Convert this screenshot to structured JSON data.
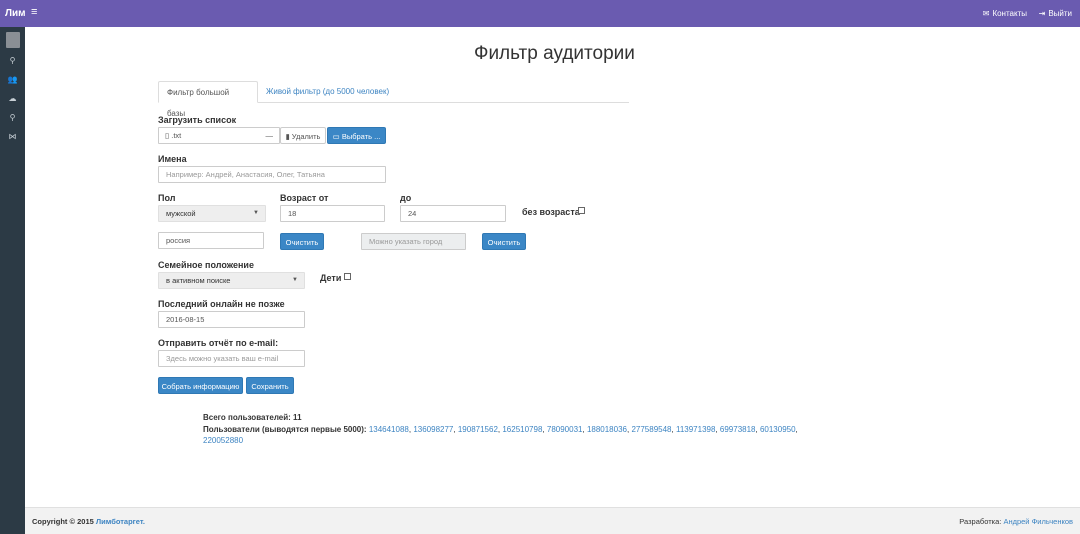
{
  "topbar": {
    "brand": "Лим",
    "menu_icon": "menu-icon",
    "contacts": "Контакты",
    "logout": "Выйти"
  },
  "sidebar": {
    "items": [
      "search-icon",
      "users-icon",
      "chat-icon",
      "pin-icon",
      "share-icon"
    ]
  },
  "page": {
    "title": "Фильтр аудитории"
  },
  "tabs": [
    {
      "label": "Фильтр большой базы",
      "active": true
    },
    {
      "label": "Живой фильтр (до 5000 человек)",
      "active": false
    }
  ],
  "upload": {
    "label": "Загрузить список",
    "file_value": ".txt",
    "clear_glyph": "—",
    "delete_label": "Удалить",
    "browse_label": "Выбрать ..."
  },
  "names": {
    "label": "Имена",
    "placeholder": "Например: Андрей, Анастасия, Олег, Татьяна"
  },
  "gender": {
    "label": "Пол",
    "value": "мужской"
  },
  "age_from": {
    "label": "Возраст от",
    "value": "18"
  },
  "age_to": {
    "label": "до",
    "value": "24"
  },
  "no_age": {
    "label": "без возраста"
  },
  "country": {
    "value": "россия",
    "clear_label": "Очистить"
  },
  "city": {
    "placeholder": "Можно указать город",
    "clear_label": "Очистить"
  },
  "marital": {
    "label": "Семейное положение",
    "value": "в активном поиске"
  },
  "children": {
    "label": "Дети"
  },
  "last_online": {
    "label": "Последний онлайн не позже",
    "value": "2016-08-15"
  },
  "email": {
    "label": "Отправить отчёт по e-mail:",
    "placeholder": "Здесь можно указать ваш e-mail"
  },
  "actions": {
    "collect": "Собрать информацию",
    "save": "Сохранить"
  },
  "results": {
    "total_text": "Всего пользователей: 11",
    "users_prefix": "Пользователи (выводятся первые 5000):",
    "user_ids": [
      "134641088",
      "136098277",
      "190871562",
      "162510798",
      "78090031",
      "188018036",
      "277589548",
      "113971398",
      "69973818",
      "60130950",
      "220052880"
    ]
  },
  "footer": {
    "copyright_prefix": "Copyright © 2015",
    "copyright_link": "Лимботаргет.",
    "dev_prefix": "Разработка:",
    "dev_link": "Андрей Фильченков"
  },
  "colors": {
    "topbar": "#6a5bb0",
    "sidebar": "#2c3a45",
    "accent": "#3b87c6"
  }
}
